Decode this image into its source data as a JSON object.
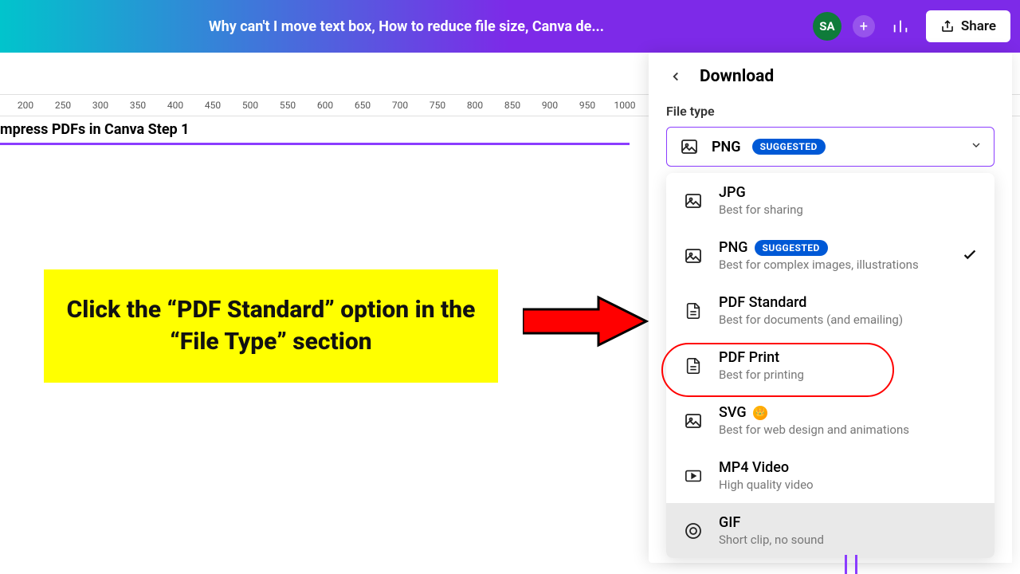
{
  "header": {
    "doc_title": "Why can't I move text box, How to reduce file size, Canva de...",
    "avatar_initials": "SA",
    "share_label": "Share"
  },
  "ruler_ticks": [
    200,
    250,
    300,
    350,
    400,
    450,
    500,
    550,
    600,
    650,
    700,
    750,
    800,
    850,
    900,
    950,
    1000
  ],
  "page": {
    "title": "mpress PDFs in Canva Step 1"
  },
  "callout": {
    "text": "Click the “PDF Standard” option in the “File Type” section"
  },
  "panel": {
    "title": "Download",
    "file_type_label": "File type",
    "selected": {
      "name": "PNG",
      "badge": "SUGGESTED"
    },
    "options": [
      {
        "name": "JPG",
        "sub": "Best for sharing",
        "icon": "image",
        "badge": ""
      },
      {
        "name": "PNG",
        "sub": "Best for complex images, illustrations",
        "icon": "image",
        "badge": "SUGGESTED",
        "checked": true
      },
      {
        "name": "PDF Standard",
        "sub": "Best for documents (and emailing)",
        "icon": "doc",
        "badge": ""
      },
      {
        "name": "PDF Print",
        "sub": "Best for printing",
        "icon": "doc",
        "badge": ""
      },
      {
        "name": "SVG",
        "sub": "Best for web design and animations",
        "icon": "image",
        "badge": "",
        "premium": true
      },
      {
        "name": "MP4 Video",
        "sub": "High quality video",
        "icon": "video",
        "badge": ""
      },
      {
        "name": "GIF",
        "sub": "Short clip, no sound",
        "icon": "gif",
        "badge": ""
      }
    ]
  }
}
